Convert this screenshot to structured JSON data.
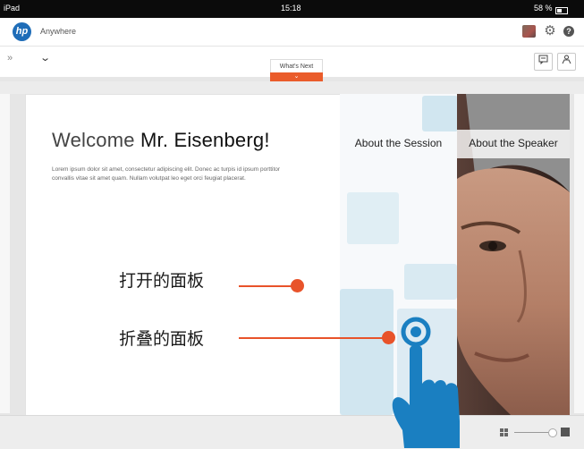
{
  "status_bar": {
    "device": "iPad",
    "time": "15:18",
    "battery": "58 %"
  },
  "app_bar": {
    "logo": "hp",
    "app_name": "Anywhere",
    "icons": [
      "avatar-icon",
      "gear-icon",
      "help-icon"
    ],
    "help_glyph": "?"
  },
  "toolbar": {
    "expand_glyph": "»",
    "dropdown_glyph": "⌄",
    "whats_next_label": "What's Next"
  },
  "welcome_panel": {
    "greeting": "Welcome",
    "name": "Mr. Eisenberg!",
    "body": "Lorem ipsum dolor sit amet, consectetur adipiscing elit. Donec ac turpis id ipsum porttitor convallis vitae sit amet quam. Nullam volutpat leo eget orci feugiat placerat."
  },
  "session_panel": {
    "title": "About the Session"
  },
  "speaker_panel": {
    "title": "About the Speaker"
  },
  "annotations": {
    "open_panel": "打开的面板",
    "folded_panel": "折叠的面板"
  },
  "colors": {
    "accent": "#e8532a",
    "hp_blue": "#1f6db8",
    "hand_blue": "#1a7fc1",
    "panel_squares": "#d1e6f0"
  }
}
